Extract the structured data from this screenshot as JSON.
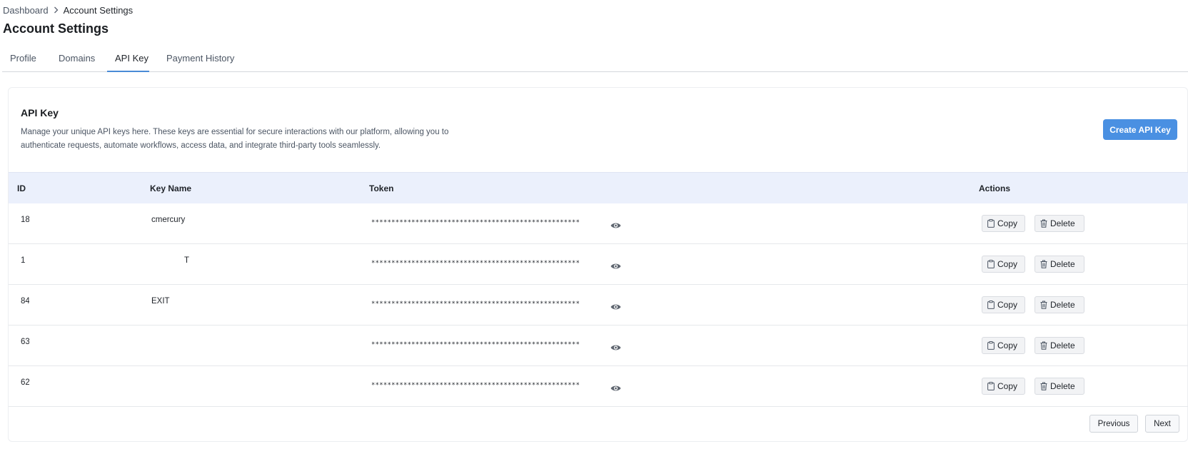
{
  "breadcrumb": {
    "root": "Dashboard",
    "current": "Account Settings"
  },
  "page": {
    "title": "Account Settings"
  },
  "tabs": [
    {
      "label": "Profile",
      "active": false
    },
    {
      "label": "Domains",
      "active": false
    },
    {
      "label": "API Key",
      "active": true
    },
    {
      "label": "Payment History",
      "active": false
    }
  ],
  "card": {
    "title": "API Key",
    "description": "Manage your unique API keys here. These keys are essential for secure interactions with our platform, allowing you to authenticate requests, automate workflows, access data, and integrate third-party tools seamlessly.",
    "create_label": "Create API Key"
  },
  "table": {
    "headers": {
      "id": "ID",
      "name": "Key Name",
      "token": "Token",
      "actions": "Actions"
    },
    "rows": [
      {
        "id": "18",
        "name": "cmercury",
        "token": "****************************************************"
      },
      {
        "id": "1",
        "name": "T",
        "token": "****************************************************"
      },
      {
        "id": "84",
        "name": "EXIT",
        "token": "****************************************************"
      },
      {
        "id": "63",
        "name": "",
        "token": "****************************************************"
      },
      {
        "id": "62",
        "name": "",
        "token": "****************************************************"
      }
    ],
    "copy_label": "Copy",
    "delete_label": "Delete"
  },
  "pagination": {
    "previous": "Previous",
    "next": "Next"
  },
  "colors": {
    "accent": "#4a90e2",
    "header_bg": "#ebf0fc",
    "tab_underline": "#4a8bd6"
  },
  "icons": {
    "eye": "eye-icon",
    "copy": "clipboard-icon",
    "delete": "trash-icon",
    "separator": "chevron-right-icon"
  }
}
